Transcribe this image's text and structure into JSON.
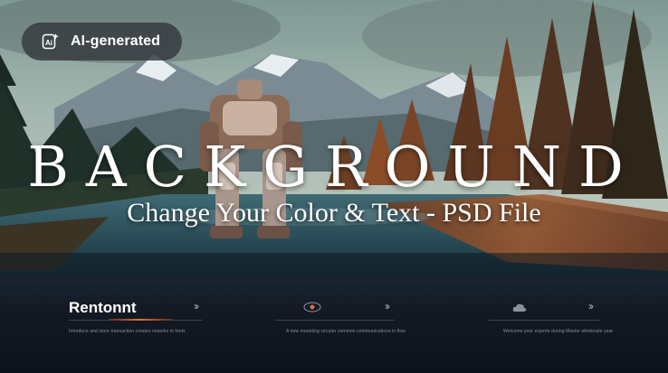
{
  "badge": {
    "label": "AI-generated",
    "icon": "ai-sparkle-icon"
  },
  "hero": {
    "headline": "BACKGROUND",
    "subline": "Change Your Color & Text - PSD File"
  },
  "panel": {
    "col1": {
      "title": "Rentonnt",
      "chevron": "››",
      "caption": "Introduce and store transaction creates reworks in fonts"
    },
    "col2": {
      "chevron": "››",
      "caption": "A new mounting circular common communications in flow"
    },
    "col3": {
      "chevron": "››",
      "caption": "Welcome your experts during Master wholesale year"
    }
  },
  "colors": {
    "accent": "#e0703a",
    "panel": "#121923"
  }
}
